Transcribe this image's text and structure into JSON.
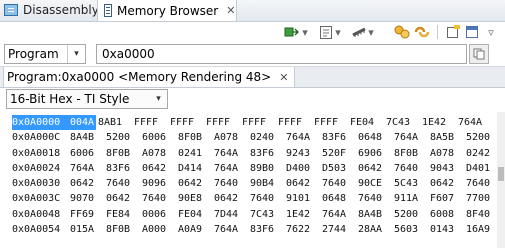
{
  "tabs": [
    {
      "label": "Disassembly",
      "icon": "disassembly-icon",
      "active": false
    },
    {
      "label": "Memory Browser",
      "icon": "memory-icon",
      "active": true
    }
  ],
  "close_glyph": "✕",
  "address_bar": {
    "space_value": "Program",
    "address_value": "0xa0000"
  },
  "rendering_tab": {
    "label": "Program:0xa0000 <Memory Rendering 48>"
  },
  "format": {
    "value": "16-Bit Hex - TI Style"
  },
  "memory": {
    "selected_address": "0x0A0000",
    "selected_word": "004A",
    "rows": [
      {
        "addr": "0x0A0000",
        "words": [
          "004A",
          "8AB1",
          "FFFF",
          "FFFF",
          "FFFF",
          "FFFF",
          "FFFF",
          "FFFF",
          "FE04",
          "7C43",
          "1E42",
          "764A"
        ]
      },
      {
        "addr": "0x0A000C",
        "words": [
          "8A4B",
          "5200",
          "6006",
          "8F0B",
          "A078",
          "0240",
          "764A",
          "83F6",
          "0648",
          "764A",
          "8A5B",
          "5200"
        ]
      },
      {
        "addr": "0x0A0018",
        "words": [
          "6006",
          "8F0B",
          "A078",
          "0241",
          "764A",
          "83F6",
          "9243",
          "520F",
          "6906",
          "8F0B",
          "A078",
          "0242"
        ]
      },
      {
        "addr": "0x0A0024",
        "words": [
          "764A",
          "83F6",
          "0642",
          "D414",
          "764A",
          "89B0",
          "D400",
          "D503",
          "0642",
          "7640",
          "9043",
          "D401"
        ]
      },
      {
        "addr": "0x0A0030",
        "words": [
          "0642",
          "7640",
          "9096",
          "0642",
          "7640",
          "90B4",
          "0642",
          "7640",
          "90CE",
          "5C43",
          "0642",
          "7640"
        ]
      },
      {
        "addr": "0x0A003C",
        "words": [
          "9070",
          "0642",
          "7640",
          "90E8",
          "0642",
          "7640",
          "9101",
          "0648",
          "7640",
          "911A",
          "F607",
          "7700"
        ]
      },
      {
        "addr": "0x0A0048",
        "words": [
          "FF69",
          "FE84",
          "0006",
          "FE04",
          "7D44",
          "7C43",
          "1E42",
          "764A",
          "8A4B",
          "5200",
          "6008",
          "8F40"
        ]
      },
      {
        "addr": "0x0A0054",
        "words": [
          "015A",
          "8F0B",
          "A000",
          "A0A9",
          "764A",
          "83F6",
          "7622",
          "2744",
          "28AA",
          "5603",
          "0143",
          "16A9"
        ]
      }
    ]
  },
  "toolbar": {
    "icons": [
      "connect-icon",
      "import-icon",
      "export-icon",
      "refresh-icon",
      "link-icon",
      "new-window-icon",
      "new-view-icon",
      "view-menu-icon"
    ]
  },
  "colors": {
    "selection": "#3399ff",
    "tab_bar": "#e3e8ee"
  }
}
